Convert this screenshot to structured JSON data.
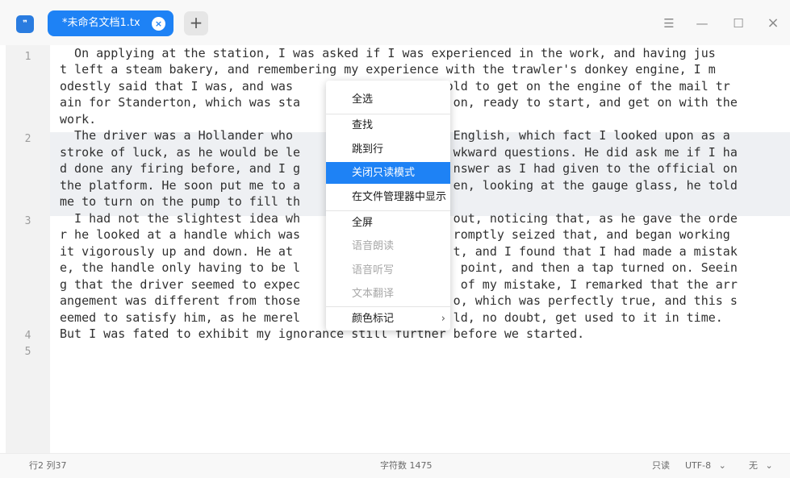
{
  "titlebar": {
    "tab_title": "*未命名文档1.tx",
    "tab_close_symbol": "×",
    "add_tab_symbol": "+",
    "menu_symbol": "☰",
    "minimize_symbol": "—",
    "maximize_symbol": "☐",
    "close_symbol": "×"
  },
  "editor": {
    "line_numbers": [
      "1",
      "2",
      "3",
      "4",
      "5"
    ],
    "visual_lines": [
      "  On applying at the station, I was asked if I was experienced in the work, and having jus",
      "t left a steam bakery, and remembering my experience with the trawler's donkey engine, I m",
      "odestly said that I was, and was                     old to get on the engine of the mail tr",
      "ain for Standerton, which was sta                     on, ready to start, and get on with the",
      "work.",
      "  The driver was a Hollander who                      English, which fact I looked upon as a",
      "stroke of luck, as he would be le                     wkward questions. He did ask me if I ha",
      "d done any firing before, and I g                     nswer as I had given to the official on",
      "the platform. He soon put me to a                     en, looking at the gauge glass, he told",
      "me to turn on the pump to fill th",
      "  I had not the slightest idea wh                     out, noticing that, as he gave the orde",
      "r he looked at a handle which was                     romptly seized that, and began working",
      "it vigorously up and down. He at                      t, and I found that I had made a mistak",
      "e, the handle only having to be l                      point, and then a tap turned on. Seein",
      "g that the driver seemed to expec                      of my mistake, I remarked that the arr",
      "angement was different from those                     o, which was perfectly true, and this s",
      "eemed to satisfy him, as he merel                     ld, no doubt, get used to it in time.",
      "But I was fated to exhibit my ignorance still further before we started."
    ]
  },
  "context_menu": {
    "items": [
      {
        "label": "全选",
        "enabled": true,
        "selected": false
      },
      {
        "label": "查找",
        "enabled": true,
        "selected": false
      },
      {
        "label": "跳到行",
        "enabled": true,
        "selected": false
      },
      {
        "label": "关闭只读模式",
        "enabled": true,
        "selected": true
      },
      {
        "label": "在文件管理器中显示",
        "enabled": true,
        "selected": false
      },
      {
        "label": "全屏",
        "enabled": true,
        "selected": false
      },
      {
        "label": "语音朗读",
        "enabled": false,
        "selected": false
      },
      {
        "label": "语音听写",
        "enabled": false,
        "selected": false
      },
      {
        "label": "文本翻译",
        "enabled": false,
        "selected": false
      },
      {
        "label": "颜色标记",
        "enabled": true,
        "selected": false,
        "has_submenu": true
      }
    ],
    "submenu_arrow": "›"
  },
  "statusbar": {
    "cursor_position": "行2 列37",
    "char_count": "字符数 1475",
    "mode": "只读",
    "encoding": "UTF-8",
    "highlight": "无",
    "dropdown_symbol": "⌄"
  },
  "colors": {
    "accent": "#1e82f5",
    "gutter_bg": "#f2f2f2",
    "current_line_bg": "#eef0f3"
  }
}
